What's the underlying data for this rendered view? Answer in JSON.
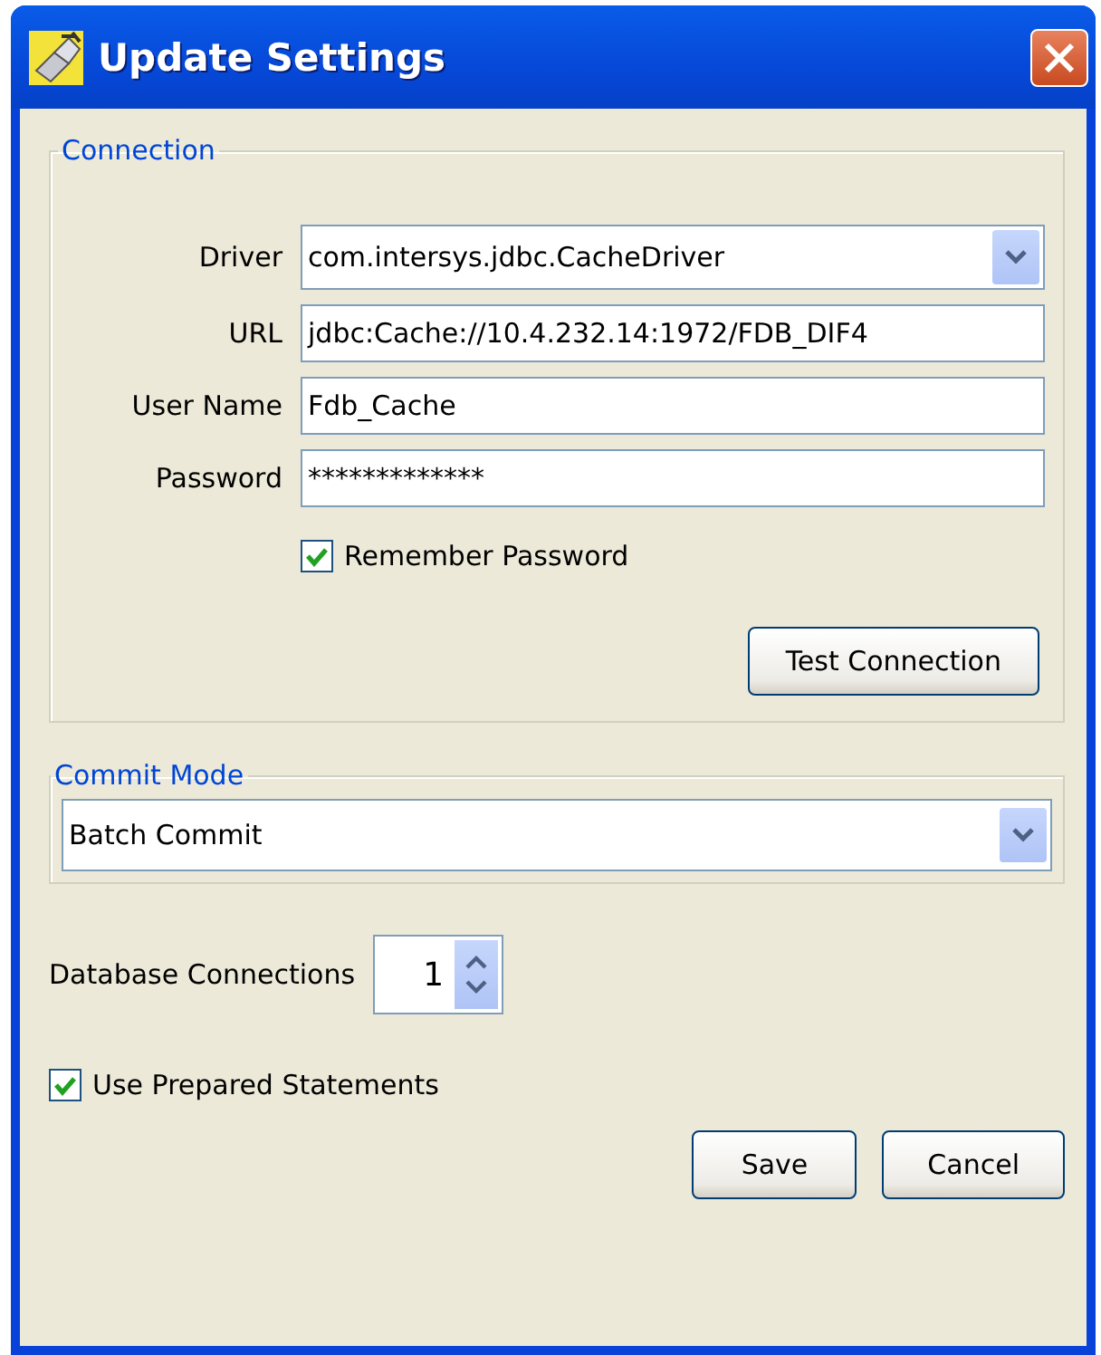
{
  "window": {
    "title": "Update Settings"
  },
  "connection": {
    "title": "Connection",
    "fields": [
      {
        "kind": "combo",
        "label": "Driver",
        "value": "com.intersys.jdbc.CacheDriver"
      },
      {
        "kind": "text",
        "label": "URL",
        "value": "jdbc:Cache://10.4.232.14:1972/FDB_DIF4"
      },
      {
        "kind": "text",
        "label": "User Name",
        "value": "Fdb_Cache"
      },
      {
        "kind": "text",
        "label": "Password",
        "value": "*************"
      }
    ],
    "remember": {
      "label": "Remember Password",
      "checked": true
    },
    "test_button": "Test Connection"
  },
  "commit_mode": {
    "title": "Commit Mode",
    "value": "Batch Commit"
  },
  "database_connections": {
    "label": "Database Connections",
    "value": "1"
  },
  "prepared": {
    "label": "Use Prepared Statements",
    "checked": true
  },
  "buttons": [
    "Save",
    "Cancel"
  ]
}
